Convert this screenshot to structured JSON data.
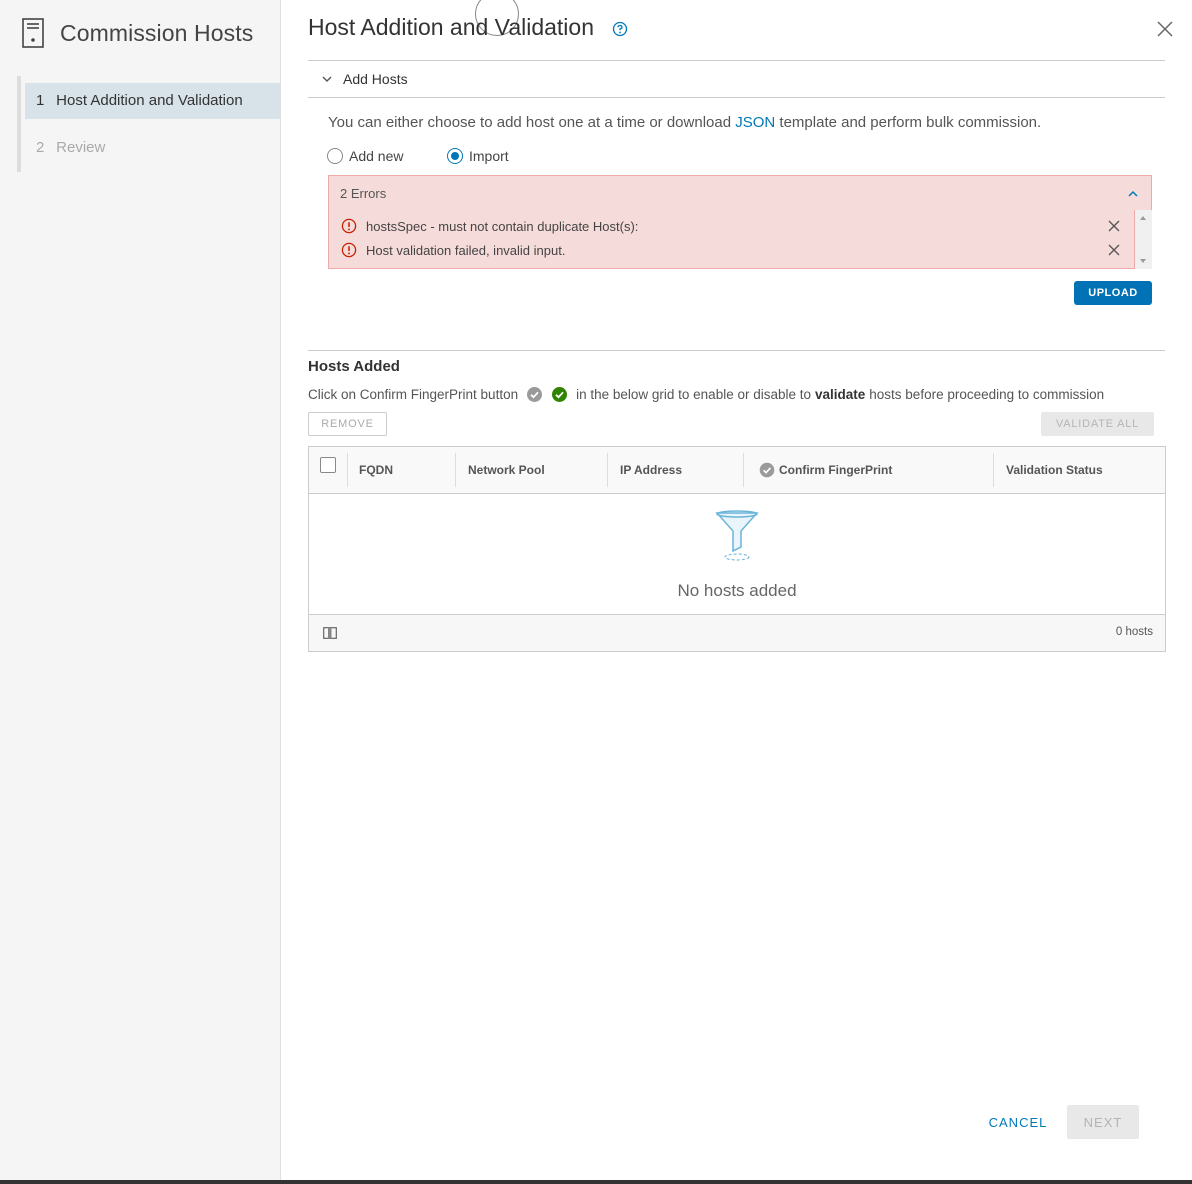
{
  "sidebar": {
    "title": "Commission Hosts",
    "steps": [
      {
        "num": "1",
        "label": "Host Addition and Validation"
      },
      {
        "num": "2",
        "label": "Review"
      }
    ]
  },
  "main": {
    "title": "Host Addition and Validation",
    "section_label": "Add Hosts",
    "desc_before": "You can either choose to add host one at a time or download ",
    "desc_link": "JSON",
    "desc_after": " template and perform bulk commission.",
    "radio_add_new": "Add new",
    "radio_import": "Import",
    "error_summary": "2 Errors",
    "errors": [
      "hostsSpec - must not contain duplicate Host(s):",
      "Host validation failed, invalid input."
    ],
    "upload_label": "UPLOAD",
    "hosts_title": "Hosts Added",
    "hint_before": "Click on Confirm FingerPrint button",
    "hint_middle": "in the below grid to enable or disable to",
    "hint_bold": "validate",
    "hint_after": "hosts before proceeding to commission",
    "remove_label": "REMOVE",
    "validate_all_label": "VALIDATE ALL",
    "columns": [
      "FQDN",
      "Network Pool",
      "IP Address",
      "Confirm FingerPrint",
      "Validation Status"
    ],
    "empty_text": "No hosts added",
    "host_count": "0 hosts",
    "cancel_label": "CANCEL",
    "next_label": "NEXT"
  },
  "colors": {
    "accent": "#0079b8",
    "error_bg": "#f5dbd9",
    "error_icon": "#c92100",
    "success": "#2f8400"
  }
}
